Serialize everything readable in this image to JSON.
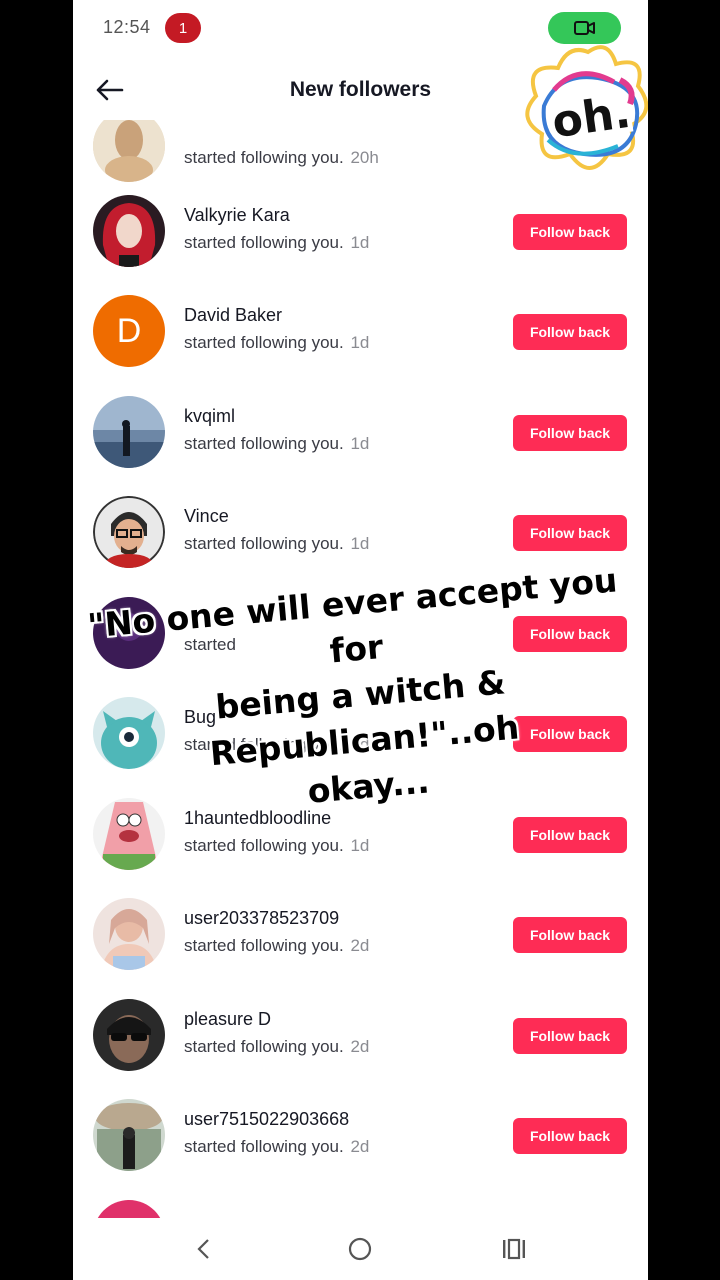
{
  "status_bar": {
    "time": "12:54",
    "notification_count": "1"
  },
  "header": {
    "title": "New followers"
  },
  "colors": {
    "accent": "#fe2c55",
    "status_pill": "#34c759",
    "badge": "#c41a24"
  },
  "rows": [
    {
      "name": "",
      "subtitle": "started following you.",
      "time": "20h",
      "avatar": "photo-tan",
      "button": "Follow back"
    },
    {
      "name": "Valkyrie Kara",
      "subtitle": "started following you.",
      "time": "1d",
      "avatar": "photo-redhair",
      "button": "Follow back"
    },
    {
      "name": "David Baker",
      "subtitle": "started following you.",
      "time": "1d",
      "avatar": "letter-D",
      "avatar_letter": "D",
      "button": "Follow back"
    },
    {
      "name": "kvqiml",
      "subtitle": "started following you.",
      "time": "1d",
      "avatar": "photo-beach",
      "button": "Follow back"
    },
    {
      "name": "Vince",
      "subtitle": "started following you.",
      "time": "1d",
      "avatar": "photo-glasses",
      "button": "Follow back"
    },
    {
      "name": "",
      "subtitle": "started",
      "time": "",
      "avatar": "photo-purple",
      "button": "Follow back"
    },
    {
      "name": "Bug",
      "subtitle": "started following you.",
      "time": "1d",
      "avatar": "cartoon-teal",
      "button": "Follow back"
    },
    {
      "name": "1hauntedbloodline",
      "subtitle": "started following you.",
      "time": "1d",
      "avatar": "cartoon-patrick",
      "button": "Follow back"
    },
    {
      "name": "user203378523709",
      "subtitle": "started following you.",
      "time": "2d",
      "avatar": "photo-woman",
      "button": "Follow back"
    },
    {
      "name": "pleasure D",
      "subtitle": "started following you.",
      "time": "2d",
      "avatar": "photo-sunglasses",
      "button": "Follow back"
    },
    {
      "name": "user7515022903668",
      "subtitle": "started following you.",
      "time": "2d",
      "avatar": "photo-outdoor",
      "button": "Follow back"
    }
  ],
  "caption": {
    "line1": "\"No one will ever accept you for",
    "line2": "being a witch & Republican!\"..oh",
    "line3": "okay..."
  },
  "sticker": {
    "text": "oh."
  }
}
